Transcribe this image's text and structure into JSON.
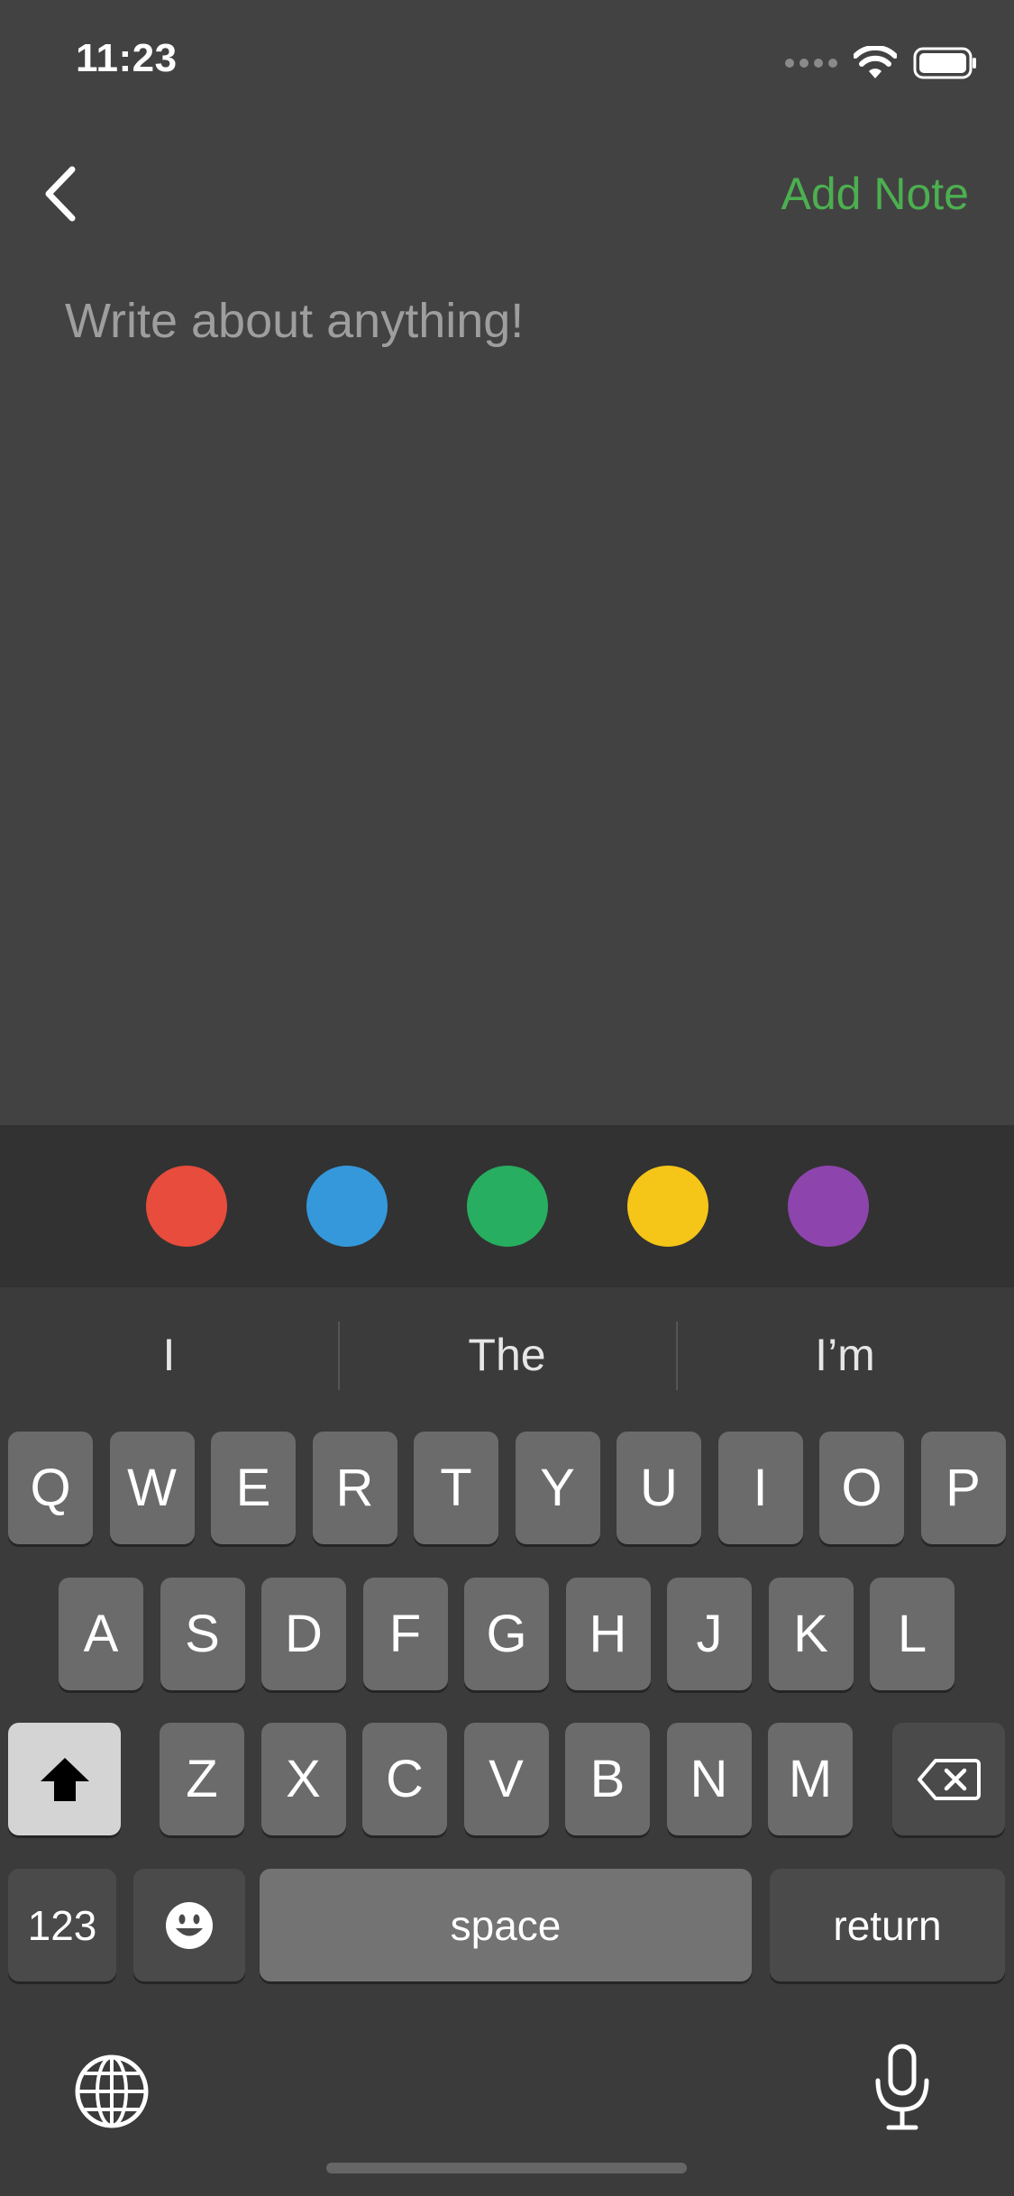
{
  "status_bar": {
    "time": "11:23"
  },
  "nav": {
    "add_note_label": "Add Note"
  },
  "editor": {
    "placeholder": "Write about anything!"
  },
  "colors": {
    "accent": "#4caf50",
    "swatches": [
      "#e74c3c",
      "#3498db",
      "#27ae60",
      "#f5c518",
      "#8e44ad"
    ]
  },
  "keyboard": {
    "suggestions": [
      "I",
      "The",
      "I’m"
    ],
    "row1": [
      "Q",
      "W",
      "E",
      "R",
      "T",
      "Y",
      "U",
      "I",
      "O",
      "P"
    ],
    "row2": [
      "A",
      "S",
      "D",
      "F",
      "G",
      "H",
      "J",
      "K",
      "L"
    ],
    "row3": [
      "Z",
      "X",
      "C",
      "V",
      "B",
      "N",
      "M"
    ],
    "numbers_label": "123",
    "space_label": "space",
    "return_label": "return"
  }
}
